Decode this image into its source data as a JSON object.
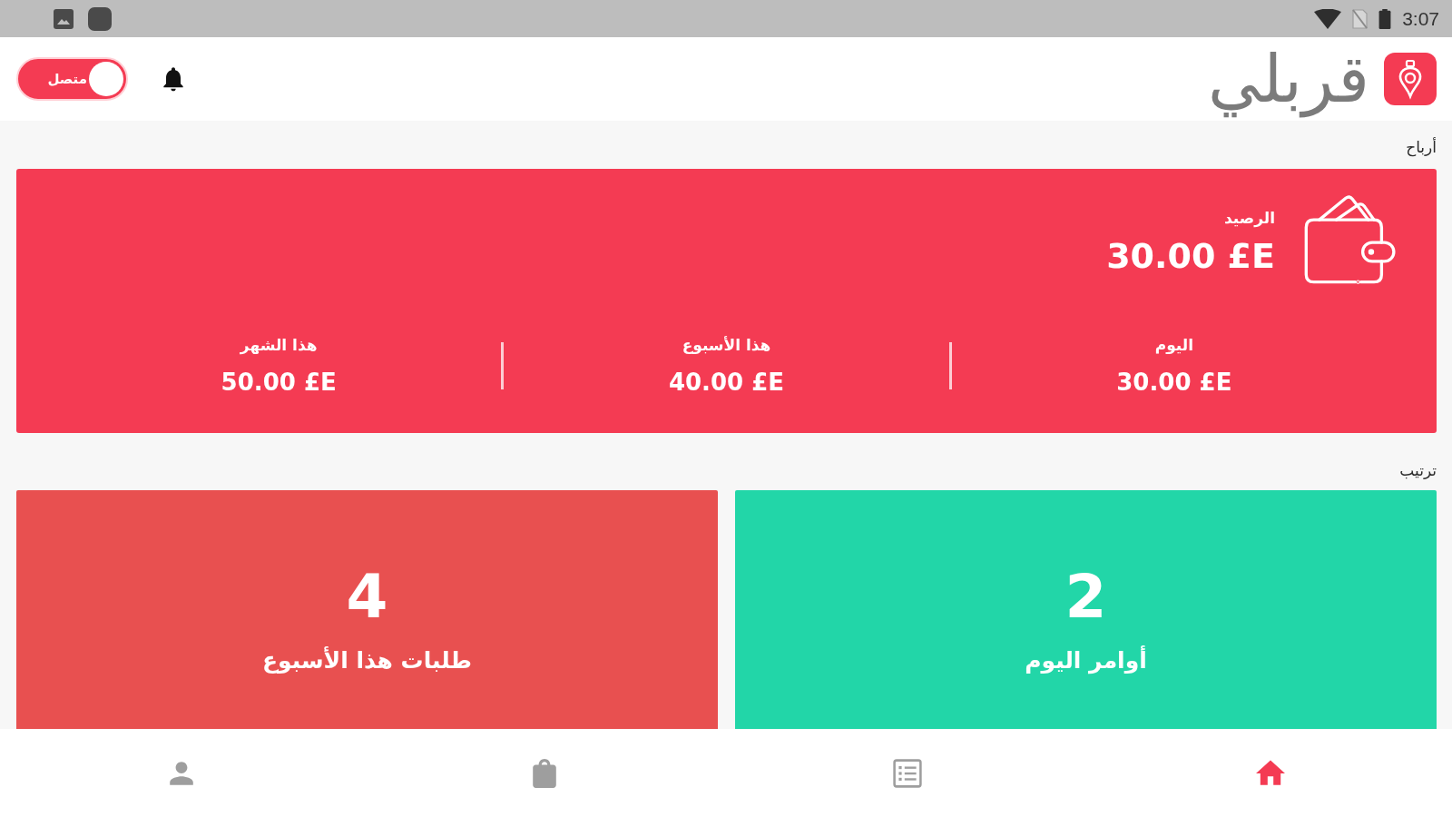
{
  "status_bar": {
    "time": "3:07"
  },
  "header": {
    "logo_text": "قربلي",
    "online_toggle": {
      "label": "متصل",
      "on": true
    }
  },
  "earnings": {
    "title": "أرباح",
    "balance_label": "الرصيد",
    "balance": "30.00 £E",
    "periods": [
      {
        "label": "اليوم",
        "value": "30.00 £E"
      },
      {
        "label": "هذا الأسبوع",
        "value": "40.00 £E"
      },
      {
        "label": "هذا الشهر",
        "value": "50.00 £E"
      }
    ]
  },
  "orders": {
    "title": "ترتيب",
    "cards": [
      {
        "count": "2",
        "label": "أوامر اليوم",
        "color": "#22d6a8"
      },
      {
        "count": "4",
        "label": "طلبات هذا الأسبوع",
        "color": "#e85050"
      }
    ]
  },
  "bottom_nav": [
    {
      "kind": "home",
      "selected": true
    },
    {
      "kind": "list",
      "selected": false
    },
    {
      "kind": "bag",
      "selected": false
    },
    {
      "kind": "person",
      "selected": false
    }
  ]
}
